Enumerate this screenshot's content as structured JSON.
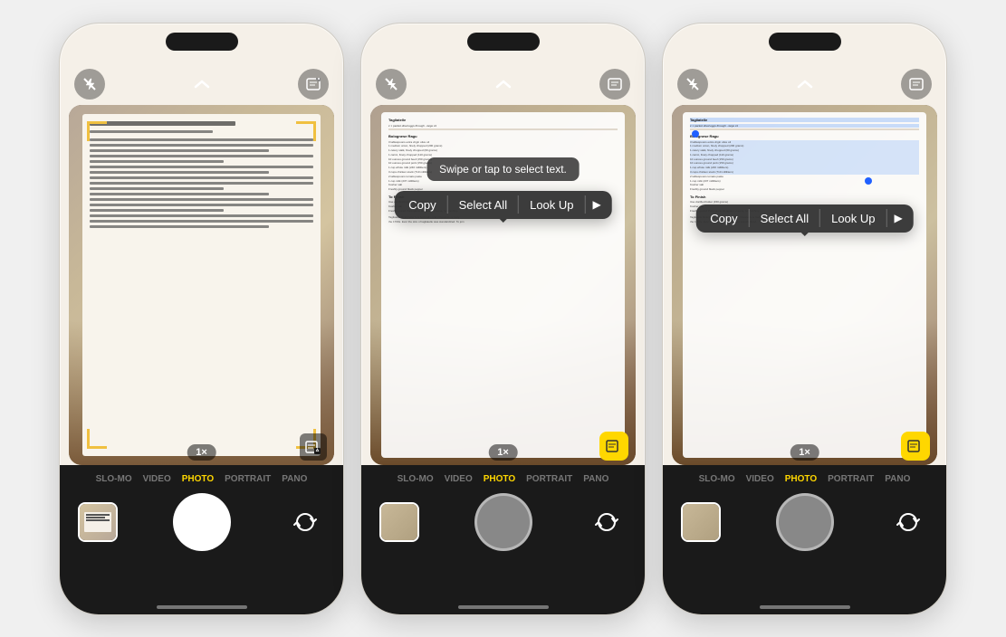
{
  "page": {
    "background": "#f0f0f0"
  },
  "phones": [
    {
      "id": "phone-1",
      "state": "scanning",
      "zoom": "1×",
      "modes": [
        "SLO-MO",
        "VIDEO",
        "PHOTO",
        "PORTRAIT",
        "PANO"
      ],
      "active_mode": "PHOTO",
      "has_toolbar": false,
      "has_hint": false,
      "has_selection": false,
      "live_text_active": false,
      "book_title": "Tagliatelle Bolognese",
      "description": "Camera viewfinder showing open cookbook"
    },
    {
      "id": "phone-2",
      "state": "text-selected",
      "zoom": "1×",
      "modes": [
        "SLO-MO",
        "VIDEO",
        "PHOTO",
        "PORTRAIT",
        "PANO"
      ],
      "active_mode": "PHOTO",
      "has_toolbar": true,
      "has_hint": true,
      "has_selection": false,
      "live_text_active": true,
      "hint_text": "Swipe or tap to select text.",
      "toolbar_items": [
        "Copy",
        "Select All",
        "Look Up",
        "▶"
      ],
      "description": "Camera with text recognition and toolbar"
    },
    {
      "id": "phone-3",
      "state": "text-highlighted",
      "zoom": "1×",
      "modes": [
        "SLO-MO",
        "VIDEO",
        "PHOTO",
        "PORTRAIT",
        "PANO"
      ],
      "active_mode": "PHOTO",
      "has_toolbar": true,
      "has_hint": false,
      "has_selection": true,
      "live_text_active": true,
      "toolbar_items": [
        "Copy",
        "Select All",
        "Look Up",
        "▶"
      ],
      "description": "Camera with highlighted text selection"
    }
  ],
  "toolbar": {
    "copy": "Copy",
    "select_all": "Select All",
    "look_up": "Look Up",
    "chevron": "▶"
  },
  "hint": {
    "text": "Swipe or tap to select text."
  },
  "icons": {
    "flash_off": "✕",
    "chevron_up": "⌃",
    "scan_circle": "◎",
    "flip": "↺",
    "zoom": "1×"
  }
}
